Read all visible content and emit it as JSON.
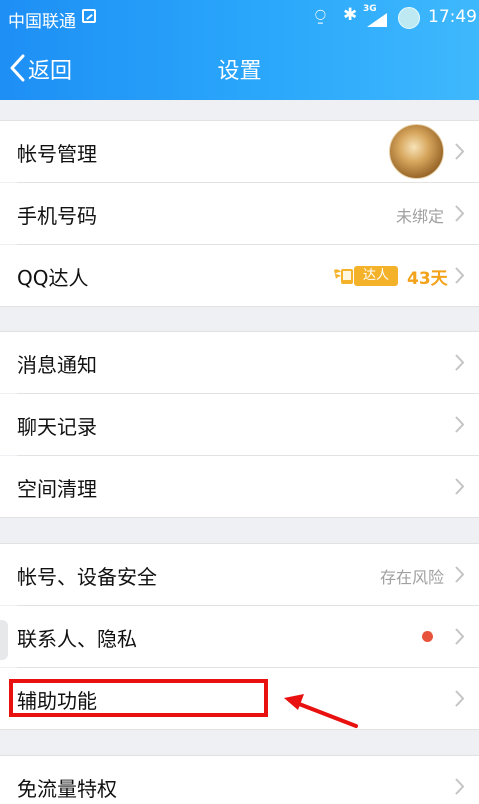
{
  "status_bar": {
    "carrier": "中国联通",
    "network": "3G",
    "time": "17:49"
  },
  "nav": {
    "back_label": "返回",
    "title": "设置"
  },
  "settings": {
    "account_management": {
      "label": "帐号管理"
    },
    "phone_number": {
      "label": "手机号码",
      "value": "未绑定"
    },
    "qq_expert": {
      "label": "QQ达人",
      "badge": "达人",
      "days": "43天"
    },
    "message_notifications": {
      "label": "消息通知"
    },
    "chat_history": {
      "label": "聊天记录"
    },
    "storage_cleanup": {
      "label": "空间清理"
    },
    "account_device_security": {
      "label": "帐号、设备安全",
      "value": "存在风险"
    },
    "contacts_privacy": {
      "label": "联系人、隐私"
    },
    "accessibility": {
      "label": "辅助功能"
    },
    "data_free_privilege": {
      "label": "免流量特权"
    }
  },
  "colors": {
    "header_blue": "#2196f3",
    "highlight_red": "#e8110f",
    "badge_gold": "#f3b22a",
    "notification_dot": "#e8533b"
  },
  "icons": {
    "back": "chevron-left-icon",
    "row_arrow": "chevron-right-icon",
    "avatar": "avatar",
    "qq_expert_badge": "winged-phone-badge-icon"
  }
}
